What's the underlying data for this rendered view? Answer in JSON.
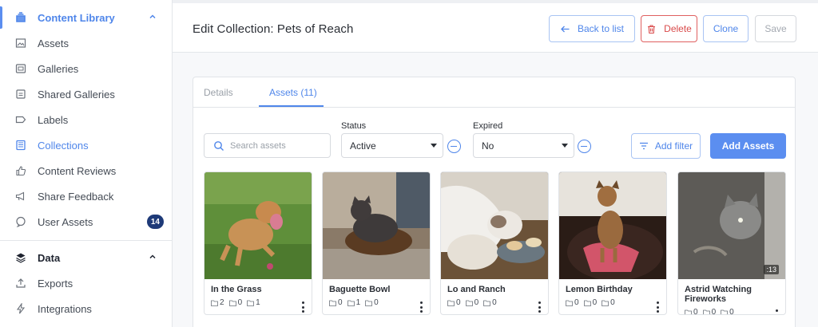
{
  "sidebar": {
    "sections": [
      {
        "label": "Content Library",
        "icon": "library-icon"
      },
      {
        "label": "Data",
        "icon": "layers-icon"
      }
    ],
    "items": [
      {
        "label": "Assets",
        "icon": "image-icon"
      },
      {
        "label": "Galleries",
        "icon": "gallery-icon"
      },
      {
        "label": "Shared Galleries",
        "icon": "shared-gallery-icon"
      },
      {
        "label": "Labels",
        "icon": "label-icon"
      },
      {
        "label": "Collections",
        "icon": "collection-icon"
      },
      {
        "label": "Content Reviews",
        "icon": "thumbs-up-icon"
      },
      {
        "label": "Share Feedback",
        "icon": "megaphone-icon"
      },
      {
        "label": "User Assets",
        "icon": "chat-icon",
        "badge": "14"
      },
      {
        "label": "Exports",
        "icon": "upload-icon"
      },
      {
        "label": "Integrations",
        "icon": "bolt-icon"
      }
    ]
  },
  "header": {
    "title": "Edit Collection: Pets of Reach",
    "back_label": "Back to list",
    "delete_label": "Delete",
    "clone_label": "Clone",
    "save_label": "Save"
  },
  "tabs": [
    {
      "label": "Details"
    },
    {
      "label": "Assets (11)"
    }
  ],
  "filters": {
    "search_placeholder": "Search assets",
    "status_label": "Status",
    "status_value": "Active",
    "expired_label": "Expired",
    "expired_value": "No",
    "add_filter_label": "Add filter",
    "add_assets_label": "Add Assets"
  },
  "assets": [
    {
      "name": "In the Grass",
      "counts": [
        "2",
        "0",
        "1"
      ]
    },
    {
      "name": "Baguette Bowl",
      "counts": [
        "0",
        "1",
        "0"
      ]
    },
    {
      "name": "Lo and Ranch",
      "counts": [
        "0",
        "0",
        "0"
      ]
    },
    {
      "name": "Lemon Birthday",
      "counts": [
        "0",
        "0",
        "0"
      ]
    },
    {
      "name": "Astrid Watching Fireworks",
      "counts": [
        "0",
        "0",
        "0"
      ],
      "duration": ":13"
    }
  ],
  "colors": {
    "accent": "#5b8ef0",
    "danger": "#d94a4a",
    "badge": "#1e3a78"
  }
}
